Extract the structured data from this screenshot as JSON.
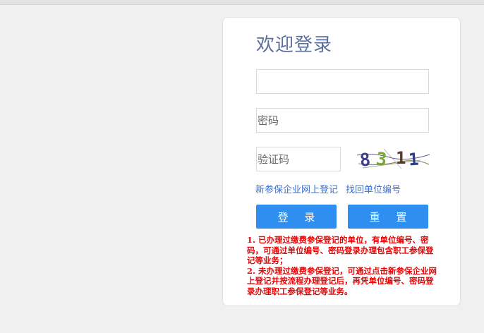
{
  "login": {
    "title": "欢迎登录",
    "username_placeholder": "",
    "password_placeholder": "密码",
    "captcha_placeholder": "验证码",
    "captcha_text": "8311",
    "register_link": "新参保企业网上登记",
    "recover_link": "找回单位编号",
    "login_button": "登 录",
    "reset_button": "重 置"
  },
  "notice": {
    "item1": "1. 已办理过缴费参保登记的单位，有单位编号、密码，可通过单位编号、密码登录办理包含职工参保登记等业务；",
    "item2": "2. 未办理过缴费参保登记，可通过点击新参保企业网上登记并按流程办理登记后，再凭单位编号、密码登录办理职工参保登记等业务。"
  },
  "colors": {
    "page_background": "#f0f0f0",
    "title": "#5b6f9a",
    "link": "#3d6fc9",
    "button": "#2f8ff0",
    "notice_text": "#e4080a"
  }
}
